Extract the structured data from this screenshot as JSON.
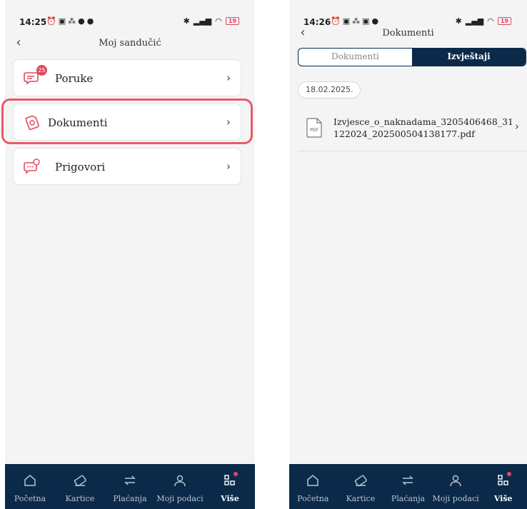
{
  "colors": {
    "navy": "#0b2a4a",
    "accent": "#e04a5a",
    "highlight": "#ea5868"
  },
  "left": {
    "status": {
      "time": "14:25",
      "battery": "19"
    },
    "header": {
      "title": "Moj sandučić"
    },
    "menu": [
      {
        "label": "Poruke",
        "icon": "messages-icon",
        "badge": "25"
      },
      {
        "label": "Dokumenti",
        "icon": "documents-icon"
      },
      {
        "label": "Prigovori",
        "icon": "complaints-icon"
      }
    ]
  },
  "right": {
    "status": {
      "time": "14:26",
      "battery": "19"
    },
    "header": {
      "title": "Dokumenti"
    },
    "tabs": [
      {
        "label": "Dokumenti",
        "active": false
      },
      {
        "label": "Izvještaji",
        "active": true
      }
    ],
    "date": "18.02.2025.",
    "document": {
      "name": "Izvjesce_o_naknadama_3205406468_31122024_202500504138177.pdf",
      "icon": "pdf-icon",
      "icon_text": "PDF"
    }
  },
  "nav": [
    {
      "label": "Početna",
      "icon": "home-icon"
    },
    {
      "label": "Kartice",
      "icon": "card-icon"
    },
    {
      "label": "Plaćanja",
      "icon": "transfer-icon"
    },
    {
      "label": "Moji podaci",
      "icon": "user-icon"
    },
    {
      "label": "Više",
      "icon": "more-icon",
      "active": true
    }
  ]
}
